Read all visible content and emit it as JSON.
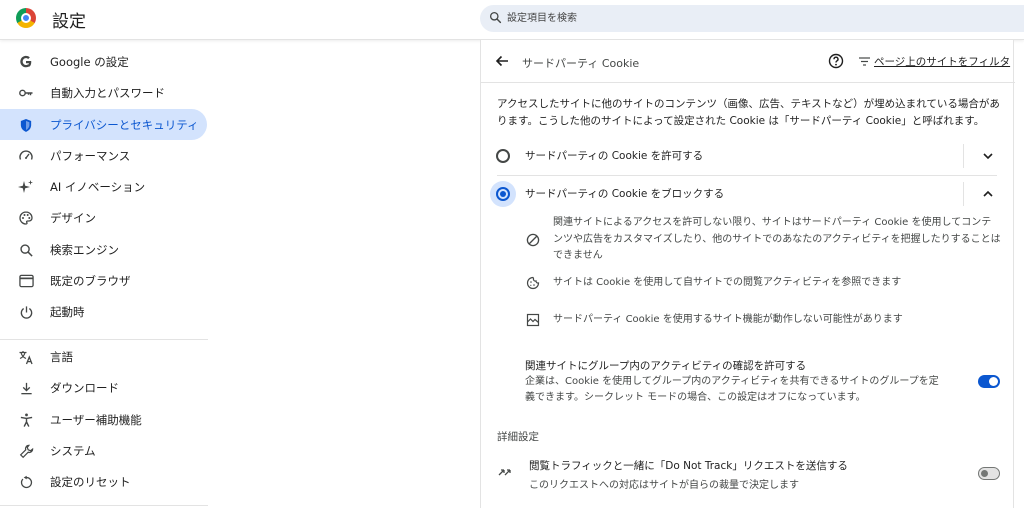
{
  "header": {
    "title": "設定",
    "search_placeholder": "設定項目を検索"
  },
  "sidebar": {
    "items": [
      {
        "label": "Google の設定",
        "icon": "google-g-icon"
      },
      {
        "label": "自動入力とパスワード",
        "icon": "key-icon"
      },
      {
        "label": "プライバシーとセキュリティ",
        "icon": "shield-icon",
        "active": true
      },
      {
        "label": "パフォーマンス",
        "icon": "speedometer-icon"
      },
      {
        "label": "AI イノベーション",
        "icon": "sparkle-icon"
      },
      {
        "label": "デザイン",
        "icon": "palette-icon"
      },
      {
        "label": "検索エンジン",
        "icon": "search-icon"
      },
      {
        "label": "既定のブラウザ",
        "icon": "browser-window-icon"
      },
      {
        "label": "起動時",
        "icon": "power-icon"
      },
      {
        "label": "言語",
        "icon": "translate-icon"
      },
      {
        "label": "ダウンロード",
        "icon": "download-icon"
      },
      {
        "label": "ユーザー補助機能",
        "icon": "accessibility-icon"
      },
      {
        "label": "システム",
        "icon": "wrench-icon"
      },
      {
        "label": "設定のリセット",
        "icon": "reset-icon"
      }
    ]
  },
  "panel": {
    "title": "サードパーティ Cookie",
    "filter_label": "ページ上のサイトをフィルタ",
    "intro": "アクセスしたサイトに他のサイトのコンテンツ（画像、広告、テキストなど）が埋め込まれている場合があります。こうした他のサイトによって設定された Cookie は「サードパーティ Cookie」と呼ばれます。",
    "options": [
      {
        "label": "サードパーティの Cookie を許可する",
        "selected": false
      },
      {
        "label": "サードパーティの Cookie をブロックする",
        "selected": true
      }
    ],
    "details": [
      {
        "icon": "block-icon",
        "text": "関連サイトによるアクセスを許可しない限り、サイトはサードパーティ Cookie を使用してコンテンツや広告をカスタマイズしたり、他のサイトでのあなたのアクティビティを把握したりすることはできません"
      },
      {
        "icon": "cookie-icon",
        "text": "サイトは Cookie を使用して自サイトでの閲覧アクティビティを参照できます"
      },
      {
        "icon": "broken-image-icon",
        "text": "サードパーティ Cookie を使用するサイト機能が動作しない可能性があります"
      }
    ],
    "related_sites": {
      "title": "関連サイトにグループ内のアクティビティの確認を許可する",
      "description": "企業は、Cookie を使用してグループ内のアクティビティを共有できるサイトのグループを定義できます。シークレット モードの場合、この設定はオフになっています。",
      "enabled": true
    },
    "advanced_title": "詳細設定",
    "dnt": {
      "title": "閲覧トラフィックと一緒に「Do Not Track」リクエストを送信する",
      "description": "このリクエストへの対応はサイトが自らの裁量で決定します",
      "enabled": false
    }
  },
  "colors": {
    "accent": "#0b57d0",
    "active_bg": "#d3e3fd",
    "search_bg": "#e9eef6"
  }
}
